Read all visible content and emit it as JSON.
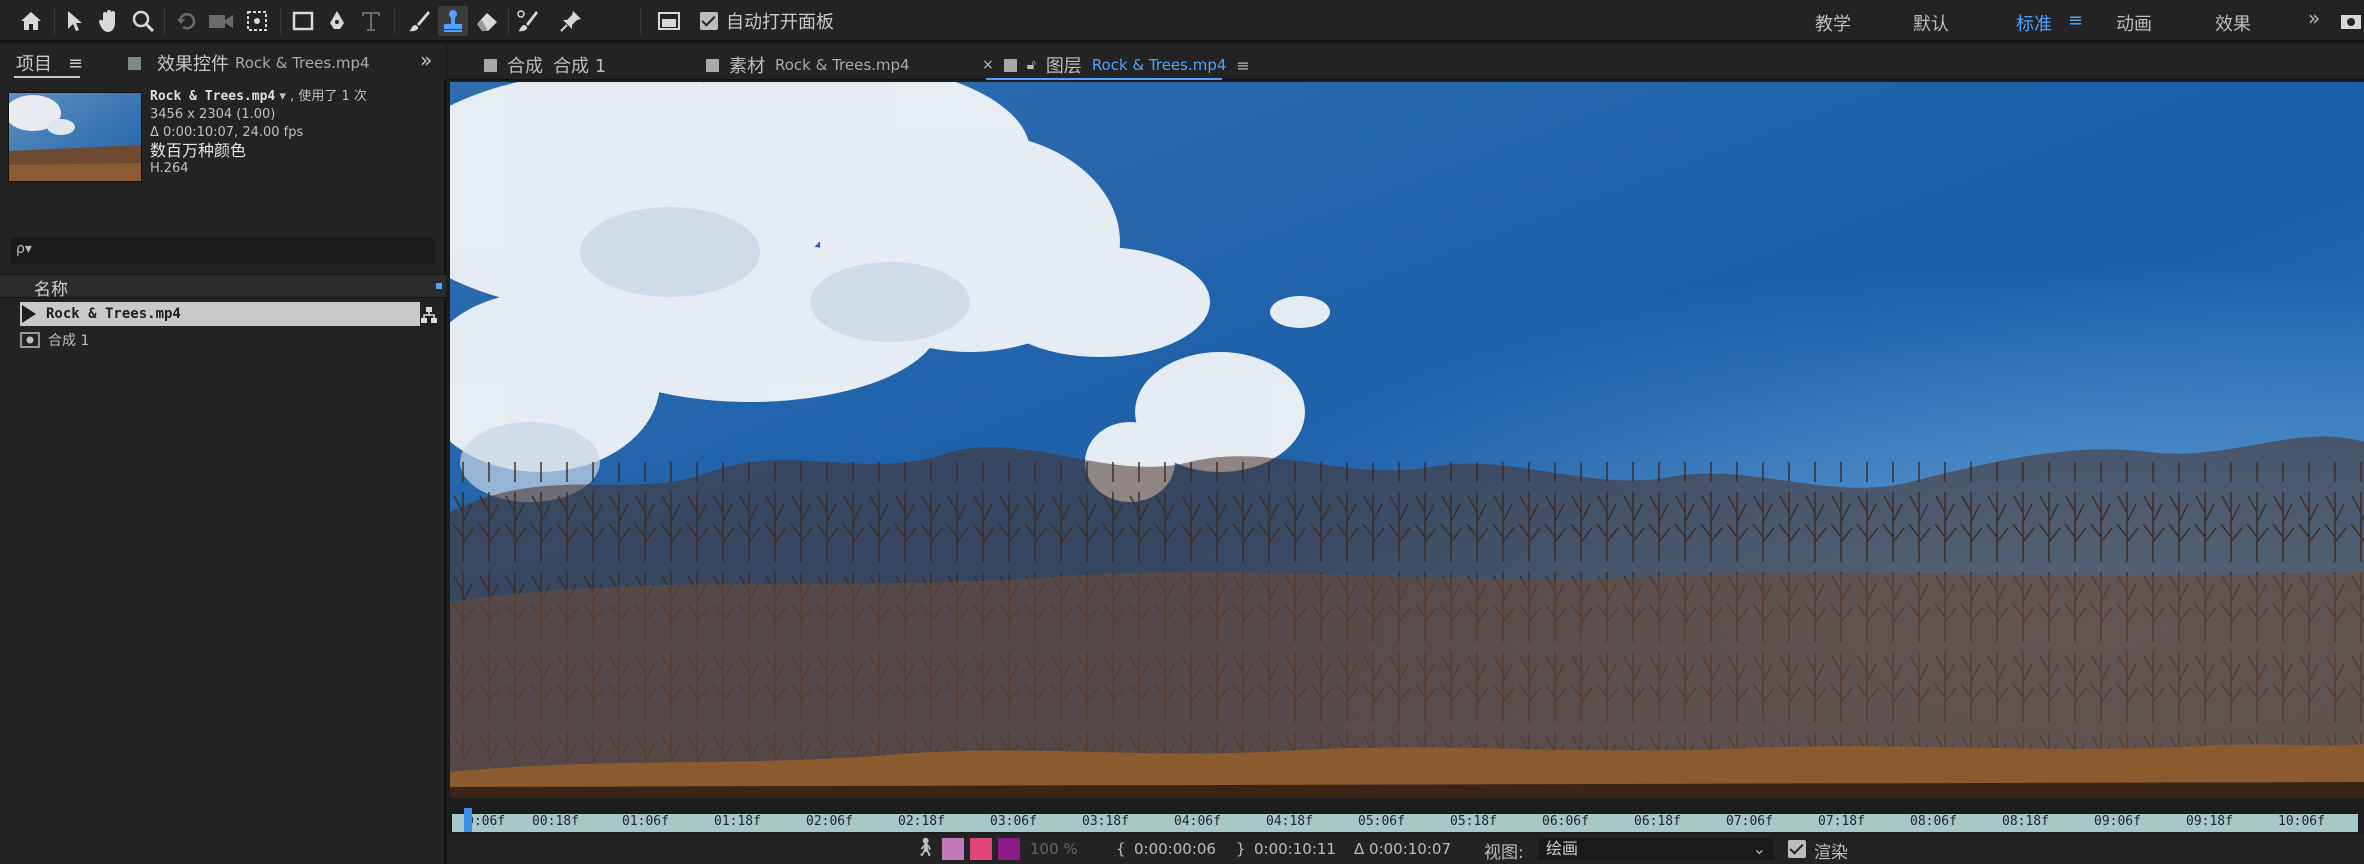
{
  "toolbar": {
    "tools": [
      "home-icon",
      "selection-icon",
      "hand-icon",
      "zoom-icon",
      "rotate-icon",
      "camera-icon",
      "pan-behind-icon",
      "rectangle-icon",
      "pen-icon",
      "text-icon",
      "brush-icon",
      "clone-stamp-icon",
      "eraser-icon",
      "roto-brush-icon",
      "puppet-pin-icon"
    ],
    "auto_open_label": "自动打开面板",
    "workspaces": [
      "教学",
      "默认",
      "标准",
      "动画",
      "效果"
    ],
    "active_workspace": "标准",
    "more": "»"
  },
  "project_panel": {
    "tab_project": "项目",
    "tab_effects": "效果控件",
    "tab_effects_file": "Rock & Trees.mp4",
    "more": "»",
    "file_name": "Rock & Trees.mp4",
    "used_label": "使用了 1 次",
    "dimensions": "3456 x 2304 (1.00)",
    "duration": "Δ 0:00:10:07, 24.00 fps",
    "colors": "数百万种颜色",
    "codec": "H.264",
    "search_placeholder": "ρ▾",
    "column_name": "名称",
    "items": [
      {
        "label": "Rock & Trees.mp4",
        "icon": "footage-icon"
      },
      {
        "label": "合成 1",
        "icon": "composition-icon"
      }
    ]
  },
  "viewer": {
    "tabs": [
      {
        "prefix": "合成",
        "label": "合成 1"
      },
      {
        "prefix": "素材",
        "label": "Rock & Trees.mp4"
      },
      {
        "prefix": "图层",
        "label": "Rock & Trees.mp4"
      }
    ],
    "active_tab": 2,
    "close_glyph": "×",
    "ruler_ticks": [
      "0:06f",
      "00:18f",
      "01:06f",
      "01:18f",
      "02:06f",
      "02:18f",
      "03:06f",
      "03:18f",
      "04:06f",
      "04:18f",
      "05:06f",
      "05:18f",
      "06:06f",
      "06:18f",
      "07:06f",
      "07:18f",
      "08:06f",
      "08:18f",
      "09:06f",
      "09:18f",
      "10:06f"
    ],
    "swatch_colors": [
      "#e0457b",
      "#8a1a8a"
    ],
    "zoom": "100 %",
    "time_in": "0:00:00:06",
    "time_out": "0:00:10:11",
    "duration": "Δ 0:00:10:07",
    "view_label": "视图:",
    "view_value": "绘画",
    "render_label": "渲染"
  }
}
